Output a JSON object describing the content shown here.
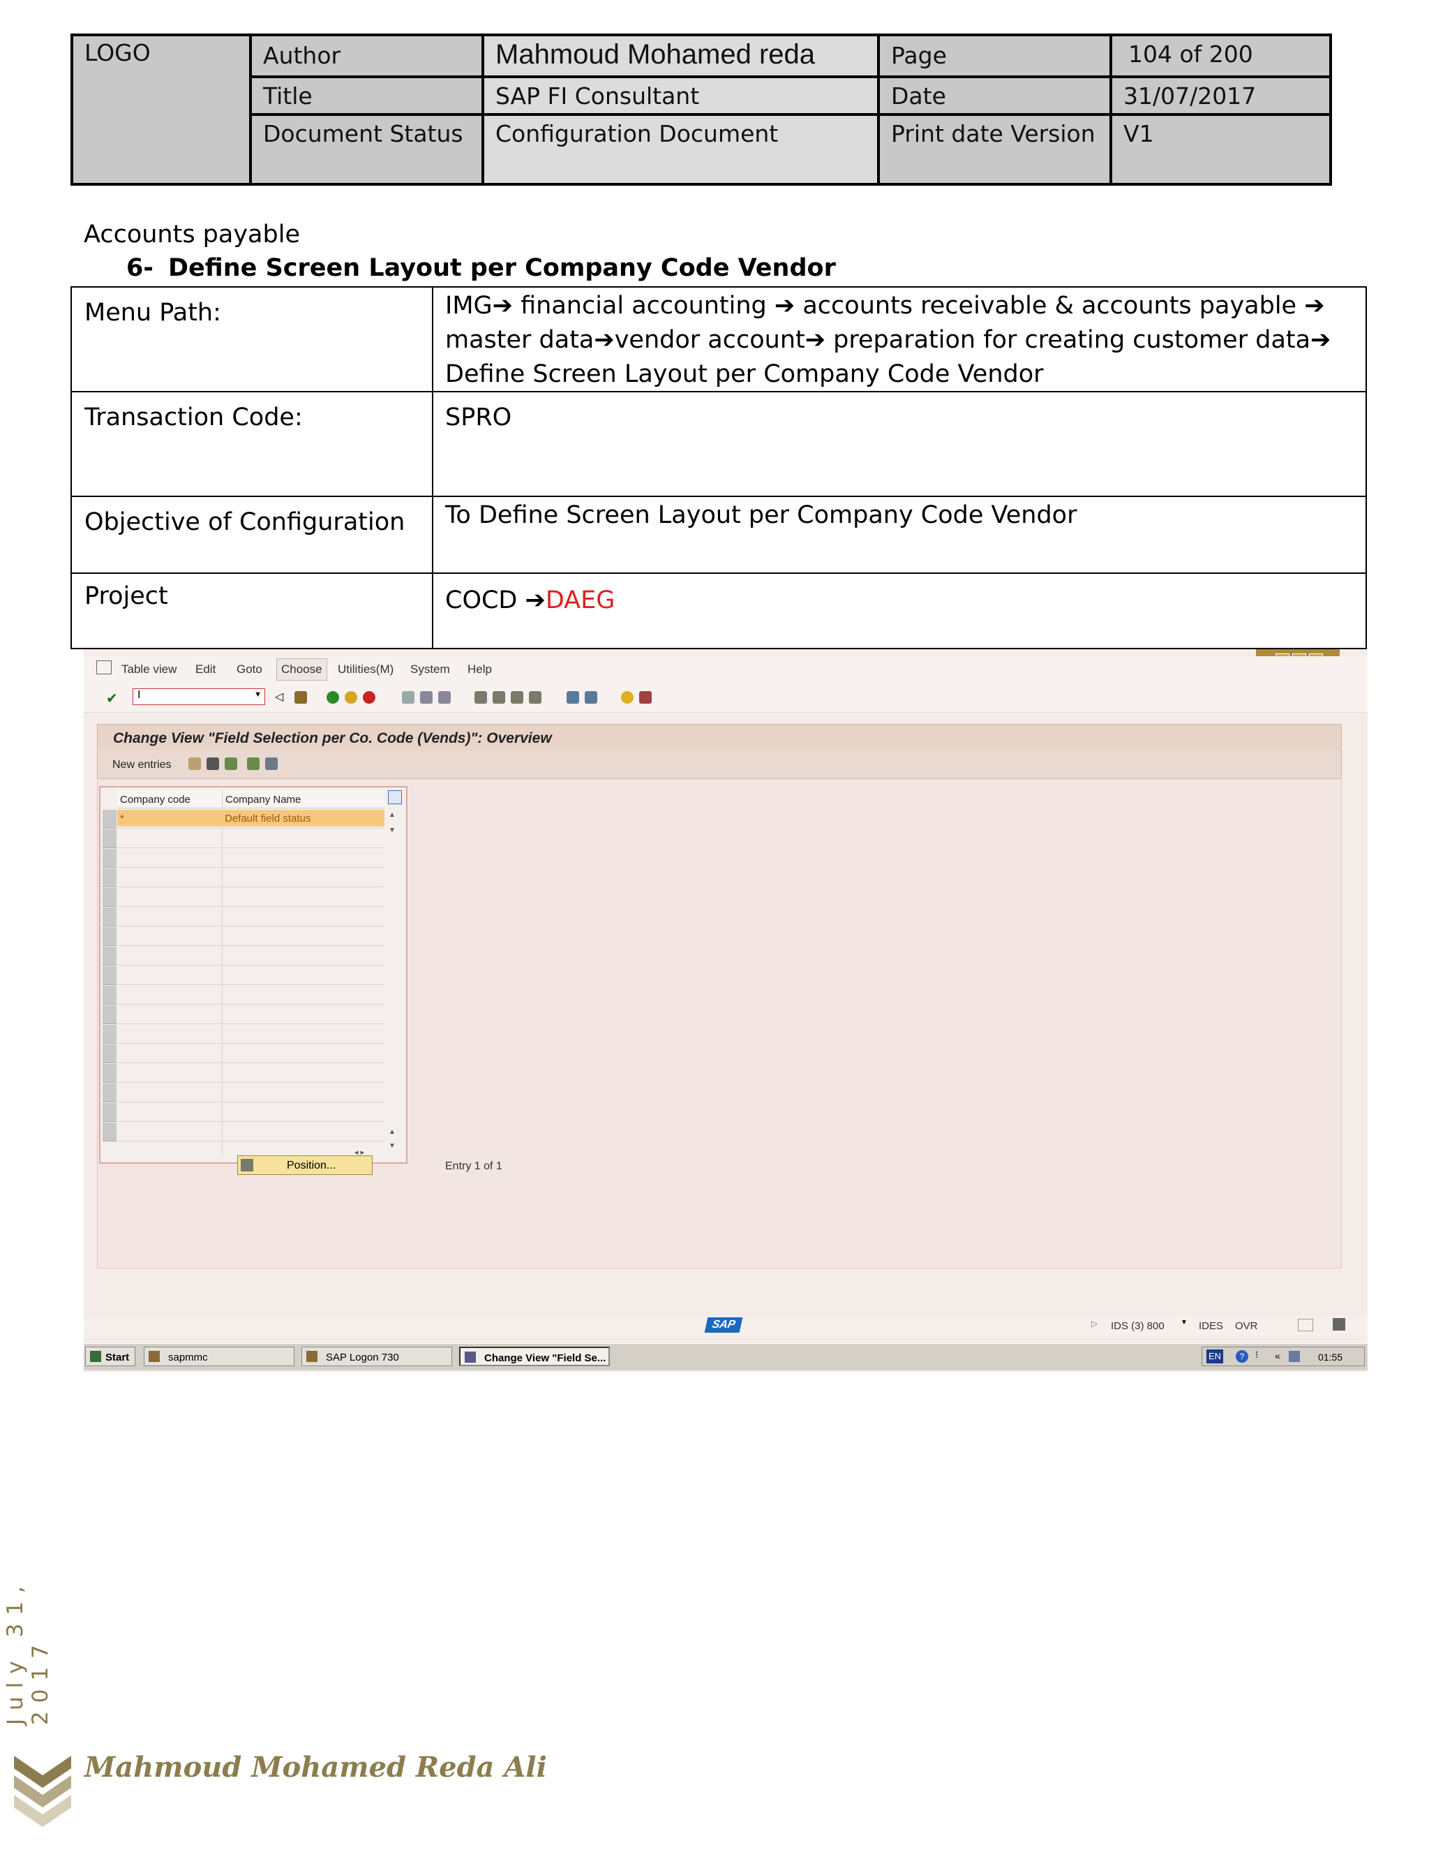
{
  "header_table": {
    "logo": "LOGO",
    "author_label": "Author",
    "author_value": "Mahmoud Mohamed reda",
    "page_label": "Page",
    "page_value": "104 of 200",
    "title_label": "Title",
    "title_value": "SAP FI Consultant",
    "date_label": "Date",
    "date_value": "31/07/2017",
    "status_label": "Document Status",
    "status_value": "Configuration Document",
    "print_label": "Print date Version",
    "print_value": "V1"
  },
  "section": {
    "heading": "Accounts payable",
    "number": "6-",
    "title": "Define Screen Layout per Company Code Vendor"
  },
  "config_table": {
    "menu_path_label": "Menu Path:",
    "menu_path_lines": [
      "IMG➔ financial accounting ➔ accounts receivable & accounts payable  ➔",
      "master data➔vendor account➔ preparation for creating customer data➔",
      "Define Screen Layout per Company Code Vendor"
    ],
    "transaction_label": "Transaction Code:",
    "transaction_value": "SPRO",
    "objective_label": "Objective of Configuration",
    "objective_value": "To Define Screen Layout per Company Code Vendor",
    "project_label": "Project",
    "project_value_prefix": "COCD ➔",
    "project_value_code": "DAEG",
    "project_code_color": "#e02020"
  },
  "sap_screen": {
    "menu": [
      "Table view",
      "Edit",
      "Goto",
      "Choose",
      "Utilities(M)",
      "System",
      "Help"
    ],
    "command_field_value": "I",
    "screen_title": "Change View \"Field Selection per Co. Code (Vends)\": Overview",
    "new_entries_label": "New entries",
    "columns": [
      "Company code",
      "Company Name"
    ],
    "rows": [
      {
        "company_code": "*",
        "company_name": "Default field status"
      }
    ],
    "position_button": "Position...",
    "entry_info": "Entry 1 of 1",
    "status_system": "IDS (3) 800",
    "status_server": "IDES",
    "status_mode": "OVR",
    "sap_logo": "SAP",
    "taskbar": {
      "start": "Start",
      "items": [
        "sapmmc",
        "SAP Logon 730",
        "Change View \"Field Se..."
      ],
      "lang": "EN",
      "clock": "01:55"
    }
  },
  "footer": {
    "side_date": "July 31, 2017",
    "author_name": "Mahmoud Mohamed Reda Ali"
  },
  "colors": {
    "accent_gold": "#8c7d4e",
    "header_gray": "#c8c8c8",
    "sap_title_bg": "#e8d3c8",
    "selected_row": "#f5c97d"
  }
}
